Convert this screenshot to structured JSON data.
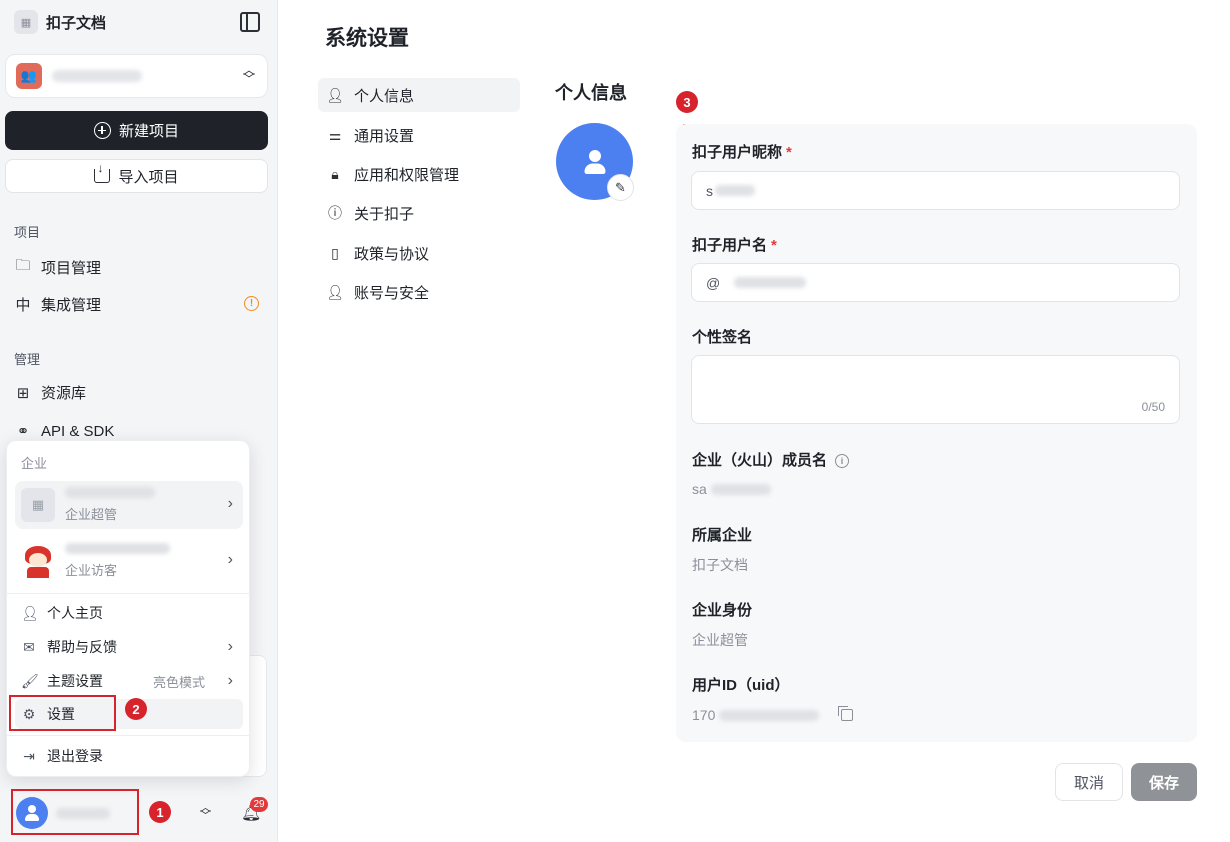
{
  "sidebar": {
    "brand": "扣子文档",
    "new_project": "新建项目",
    "import_project": "导入项目",
    "section_project": "项目",
    "project_mgmt": "项目管理",
    "integration_mgmt": "集成管理",
    "section_manage": "管理",
    "resource_lib": "资源库",
    "api_sdk": "API & SDK",
    "notification_count": "29"
  },
  "popup": {
    "section_label": "企业",
    "orgs": [
      {
        "role": "企业超管"
      },
      {
        "role": "企业访客"
      }
    ],
    "menu": {
      "profile": "个人主页",
      "help": "帮助与反馈",
      "theme": "主题设置",
      "theme_value": "亮色模式",
      "settings": "设置",
      "logout": "退出登录"
    }
  },
  "annotations": [
    "1",
    "2",
    "3"
  ],
  "main": {
    "title": "系统设置",
    "nav": [
      "个人信息",
      "通用设置",
      "应用和权限管理",
      "关于扣子",
      "政策与协议",
      "账号与安全"
    ],
    "section_title": "个人信息",
    "form": {
      "nickname_label": "扣子用户昵称",
      "nickname_prefix": "s",
      "username_label": "扣子用户名",
      "username_prefix": "@",
      "required_mark": "*",
      "signature_label": "个性签名",
      "signature_counter": "0/50",
      "member_label": "企业（火山）成员名",
      "member_value_prefix": "sa",
      "org_label": "所属企业",
      "org_value": "扣子文档",
      "identity_label": "企业身份",
      "identity_value": "企业超管",
      "uid_label": "用户ID（uid）",
      "uid_value_prefix": "170"
    },
    "cancel": "取消",
    "save": "保存"
  },
  "colors": {
    "accent_blue": "#4c7ff0",
    "annotation_red": "#d6232c",
    "warning_orange": "#f08a24",
    "primary_dark": "#1f2329"
  }
}
